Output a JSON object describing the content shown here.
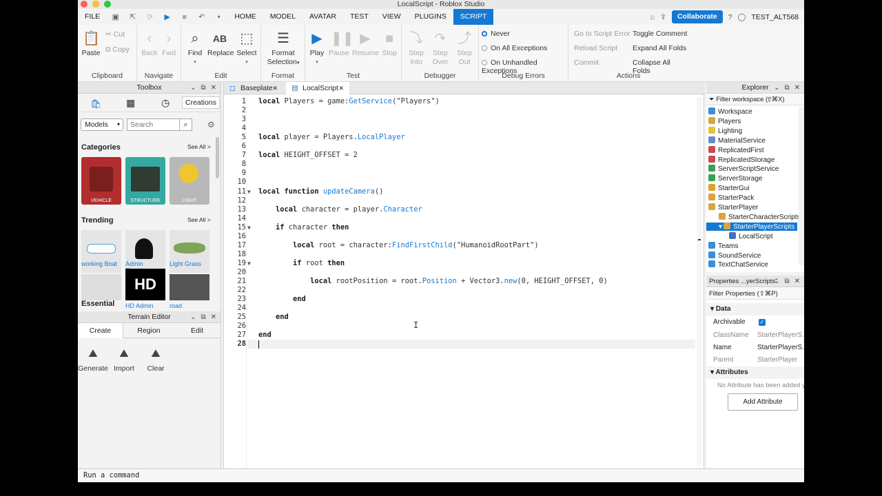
{
  "window_title": "LocalScript - Roblox Studio",
  "menu": {
    "file": "FILE",
    "tabs": [
      "HOME",
      "MODEL",
      "AVATAR",
      "TEST",
      "VIEW",
      "PLUGINS",
      "SCRIPT"
    ],
    "collaborate": "Collaborate",
    "username": "TEST_ALT568"
  },
  "ribbon": {
    "clipboard": {
      "paste": "Paste",
      "cut": "Cut",
      "copy": "Copy",
      "label": "Clipboard"
    },
    "navigate": {
      "back": "Back",
      "fwd": "Fwd",
      "label": "Navigate"
    },
    "edit": {
      "find": "Find",
      "replace": "Replace",
      "select": "Select",
      "label": "Edit"
    },
    "format": {
      "format_selection_1": "Format",
      "format_selection_2": "Selection",
      "label": "Format"
    },
    "test": {
      "play": "Play",
      "pause": "Pause",
      "resume": "Resume",
      "stop": "Stop",
      "label": "Test"
    },
    "debugger": {
      "step_into_1": "Step",
      "step_into_2": "Into",
      "step_over_1": "Step",
      "step_over_2": "Over",
      "step_out_1": "Step",
      "step_out_2": "Out",
      "label": "Debugger"
    },
    "debug_errors": {
      "never": "Never",
      "all": "On All Exceptions",
      "unhandled": "On Unhandled Exceptions",
      "label": "Debug Errors"
    },
    "actions": {
      "goto": "Go to Script Error",
      "reload": "Reload Script",
      "commit": "Commit",
      "toggle": "Toggle Comment",
      "expand": "Expand All Folds",
      "collapse": "Collapse All Folds",
      "label": "Actions"
    }
  },
  "toolbox": {
    "title": "Toolbox",
    "creations": "Creations",
    "dropdown": "Models",
    "search_placeholder": "Search",
    "categories_title": "Categories",
    "see_all": "See All >",
    "categories": [
      "VEHICLE",
      "STRUCTURE",
      "LIGHT"
    ],
    "trending_title": "Trending",
    "trending": [
      "working Boat",
      "Admin Flashl...",
      "Light Grass"
    ],
    "trending_row2": [
      "HD Admin",
      "road"
    ],
    "hd_text": "HD",
    "essential": "Essential"
  },
  "terrain": {
    "title": "Terrain Editor",
    "tabs": [
      "Create",
      "Region",
      "Edit"
    ],
    "tools": [
      "Generate",
      "Import",
      "Clear"
    ]
  },
  "editor": {
    "tabs": [
      "Baseplate",
      "LocalScript"
    ],
    "code": [
      [
        {
          "k": "kw",
          "t": "local"
        },
        {
          "t": " Players = game:"
        },
        {
          "k": "fn",
          "t": "GetService"
        },
        {
          "t": "(\"Players\")"
        }
      ],
      [],
      [],
      [],
      [
        {
          "k": "kw",
          "t": "local"
        },
        {
          "t": " player = Players."
        },
        {
          "k": "fn",
          "t": "LocalPlayer"
        }
      ],
      [],
      [
        {
          "k": "kw",
          "t": "local"
        },
        {
          "t": " HEIGHT_OFFSET = 2"
        }
      ],
      [],
      [],
      [],
      [
        {
          "k": "kw",
          "t": "local function"
        },
        {
          "t": " "
        },
        {
          "k": "fn",
          "t": "updateCamera"
        },
        {
          "t": "()"
        }
      ],
      [],
      [
        {
          "t": "    "
        },
        {
          "k": "kw",
          "t": "local"
        },
        {
          "t": " character = player."
        },
        {
          "k": "fn",
          "t": "Character"
        }
      ],
      [],
      [
        {
          "t": "    "
        },
        {
          "k": "kw",
          "t": "if"
        },
        {
          "t": " character "
        },
        {
          "k": "kw",
          "t": "then"
        }
      ],
      [],
      [
        {
          "t": "        "
        },
        {
          "k": "kw",
          "t": "local"
        },
        {
          "t": " root = character:"
        },
        {
          "k": "fn",
          "t": "FindFirstChild"
        },
        {
          "t": "(\"HumanoidRootPart\")"
        }
      ],
      [],
      [
        {
          "t": "        "
        },
        {
          "k": "kw",
          "t": "if"
        },
        {
          "t": " root "
        },
        {
          "k": "kw",
          "t": "then"
        }
      ],
      [],
      [
        {
          "t": "            "
        },
        {
          "k": "kw",
          "t": "local"
        },
        {
          "t": " rootPosition = root."
        },
        {
          "k": "fn",
          "t": "Position"
        },
        {
          "t": " + Vector3."
        },
        {
          "k": "fn",
          "t": "new"
        },
        {
          "t": "(0, HEIGHT_OFFSET, 0)"
        }
      ],
      [],
      [
        {
          "t": "        "
        },
        {
          "k": "kw",
          "t": "end"
        }
      ],
      [],
      [
        {
          "t": "    "
        },
        {
          "k": "kw",
          "t": "end"
        }
      ],
      [],
      [
        {
          "k": "kw",
          "t": "end"
        }
      ],
      []
    ]
  },
  "explorer": {
    "title": "Explorer",
    "filter": "Filter workspace (⇧⌘X)",
    "items": [
      {
        "name": "Workspace",
        "color": "#3a8fd6",
        "indent": 0
      },
      {
        "name": "Players",
        "color": "#d9a441",
        "indent": 0
      },
      {
        "name": "Lighting",
        "color": "#e5c33a",
        "indent": 0
      },
      {
        "name": "MaterialService",
        "color": "#6a8fbf",
        "indent": 0
      },
      {
        "name": "ReplicatedFirst",
        "color": "#c94c4c",
        "indent": 0
      },
      {
        "name": "ReplicatedStorage",
        "color": "#c94c4c",
        "indent": 0
      },
      {
        "name": "ServerScriptService",
        "color": "#3aa055",
        "indent": 0
      },
      {
        "name": "ServerStorage",
        "color": "#3aa055",
        "indent": 0
      },
      {
        "name": "StarterGui",
        "color": "#e0a030",
        "indent": 0
      },
      {
        "name": "StarterPack",
        "color": "#d9a441",
        "indent": 0
      },
      {
        "name": "StarterPlayer",
        "color": "#d9a441",
        "indent": 0
      },
      {
        "name": "StarterCharacterScripts",
        "color": "#d9a441",
        "indent": 1
      },
      {
        "name": "StarterPlayerScripts",
        "color": "#d9a441",
        "indent": 1,
        "selected": true
      },
      {
        "name": "LocalScript",
        "color": "#4a6fbf",
        "indent": 2
      },
      {
        "name": "Teams",
        "color": "#3a8fd6",
        "indent": 0
      },
      {
        "name": "SoundService",
        "color": "#3a8fd6",
        "indent": 0
      },
      {
        "name": "TextChatService",
        "color": "#3a8fd6",
        "indent": 0
      }
    ]
  },
  "properties": {
    "title": "Properties ...yerScripts\"",
    "filter": "Filter Properties (⇧⌘P)",
    "data_section": "Data",
    "rows": [
      {
        "label": "Archivable",
        "value": ""
      },
      {
        "label": "ClassName",
        "value": "StarterPlayerS..."
      },
      {
        "label": "Name",
        "value": "StarterPlayerS..."
      },
      {
        "label": "Parent",
        "value": "StarterPlayer"
      }
    ],
    "attributes_section": "Attributes",
    "no_attr": "No Attribute has been added y",
    "add_attr": "Add Attribute"
  },
  "command_bar": {
    "placeholder": "Run a command"
  },
  "colors": {
    "accent": "#1479d4"
  }
}
